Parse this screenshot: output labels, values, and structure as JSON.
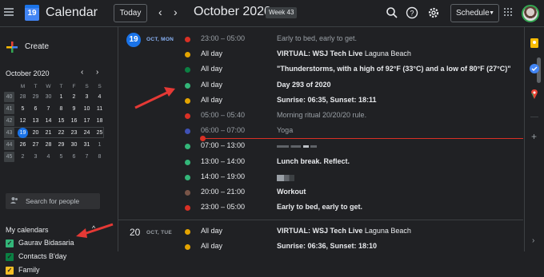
{
  "header": {
    "app_title": "Calendar",
    "logo_day": "19",
    "today_label": "Today",
    "prev_icon": "chevron-left-icon",
    "next_icon": "chevron-right-icon",
    "period": "October 2020",
    "week_badge": "Week 43",
    "view_label": "Schedule",
    "icons": [
      "search-icon",
      "help-icon",
      "gear-icon",
      "apps-icon",
      "avatar"
    ]
  },
  "sidebar": {
    "create_label": "Create",
    "mini_title": "October 2020",
    "mini_day_headers": [
      "M",
      "T",
      "W",
      "T",
      "F",
      "S",
      "S"
    ],
    "mini_weeks": [
      {
        "week": "40",
        "days": [
          "28",
          "29",
          "30",
          "1",
          "2",
          "3",
          "4"
        ]
      },
      {
        "week": "41",
        "days": [
          "5",
          "6",
          "7",
          "8",
          "9",
          "10",
          "11"
        ]
      },
      {
        "week": "42",
        "days": [
          "12",
          "13",
          "14",
          "15",
          "16",
          "17",
          "18"
        ]
      },
      {
        "week": "43",
        "days": [
          "19",
          "20",
          "21",
          "22",
          "23",
          "24",
          "25"
        ]
      },
      {
        "week": "44",
        "days": [
          "26",
          "27",
          "28",
          "29",
          "30",
          "31",
          "1"
        ]
      },
      {
        "week": "45",
        "days": [
          "2",
          "3",
          "4",
          "5",
          "6",
          "7",
          "8"
        ]
      }
    ],
    "search_people": "Search for people",
    "my_calendars_title": "My calendars",
    "calendars": [
      {
        "name": "Gaurav Bidasaria",
        "color": "#33b679"
      },
      {
        "name": "Contacts B'day",
        "color": "#0b8043"
      },
      {
        "name": "Family",
        "color": "#f6bf26"
      }
    ]
  },
  "schedule": {
    "day1": {
      "num": "19",
      "label": "OCT, MON"
    },
    "day2": {
      "num": "20",
      "label": "OCT, TUE"
    },
    "day1_events": [
      {
        "time": "23:00 – 05:00",
        "title": "Early to bed, early to get.",
        "location": "",
        "color": "#d93025",
        "past": true
      },
      {
        "time": "All day",
        "title": "VIRTUAL: WSJ Tech Live",
        "location": "Laguna Beach",
        "color": "#e4a400",
        "past": false
      },
      {
        "time": "All day",
        "title": "\"Thunderstorms, with a high of 92°F (33°C) and a low of 80°F (27°C)\"",
        "location": "",
        "color": "#0b8043",
        "past": false
      },
      {
        "time": "All day",
        "title": "Day 293 of 2020",
        "location": "",
        "color": "#33b679",
        "past": false
      },
      {
        "time": "All day",
        "title": "Sunrise: 06:35, Sunset: 18:11",
        "location": "",
        "color": "#e4a400",
        "past": false
      },
      {
        "time": "05:00 – 05:40",
        "title": "Morning ritual 20/20/20 rule.",
        "location": "",
        "color": "#d93025",
        "past": true
      },
      {
        "time": "06:00 – 07:00",
        "title": "Yoga",
        "location": "",
        "color": "#3f51b5",
        "past": true
      },
      {
        "time": "07:00 – 13:00",
        "title": "",
        "location": "",
        "color": "#33b679",
        "past": false
      },
      {
        "time": "13:00 – 14:00",
        "title": "Lunch break. Reflect.",
        "location": "",
        "color": "#33b679",
        "past": false
      },
      {
        "time": "14:00 – 19:00",
        "title": "",
        "location": "",
        "color": "#33b679",
        "past": false
      },
      {
        "time": "20:00 – 21:00",
        "title": "Workout",
        "location": "",
        "color": "#795548",
        "past": false
      },
      {
        "time": "23:00 – 05:00",
        "title": "Early to bed, early to get.",
        "location": "",
        "color": "#d93025",
        "past": false
      }
    ],
    "day2_events": [
      {
        "time": "All day",
        "title": "VIRTUAL: WSJ Tech Live",
        "location": "Laguna Beach",
        "color": "#e4a400",
        "past": false
      },
      {
        "time": "All day",
        "title": "Sunrise: 06:36, Sunset: 18:10",
        "location": "",
        "color": "#e4a400",
        "past": false
      }
    ]
  },
  "rightbar": {
    "icons": [
      "keep-icon",
      "tasks-icon",
      "maps-icon",
      "add-icon",
      "expand-icon"
    ]
  }
}
